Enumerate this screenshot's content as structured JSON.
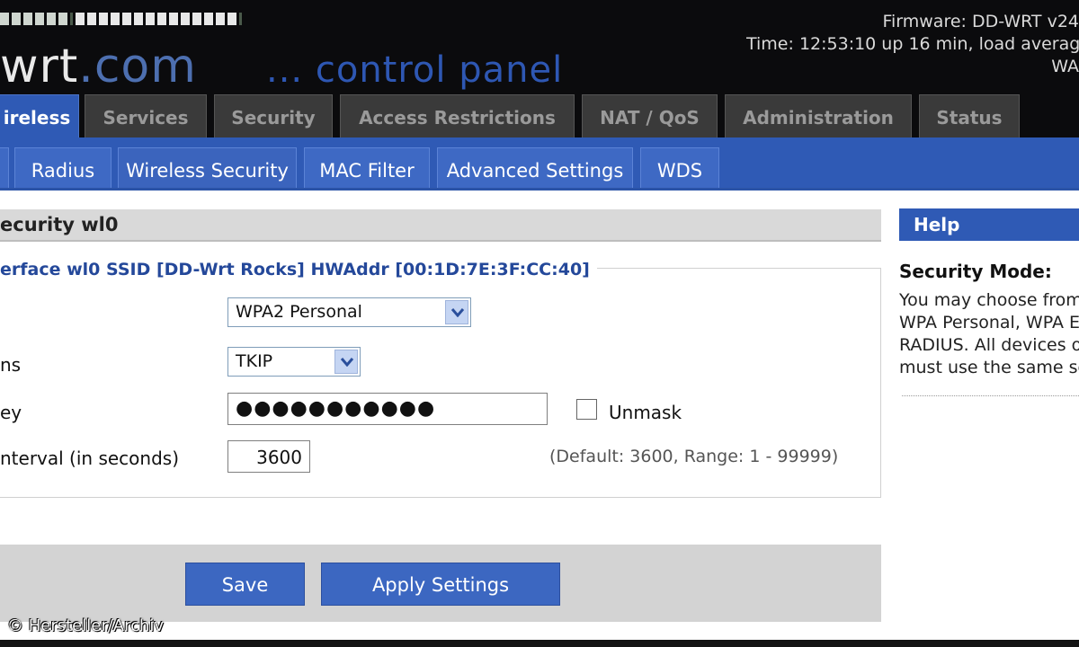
{
  "header": {
    "logo_text": "wrt",
    "logo_suffix": ".com",
    "panel_title": "... control panel",
    "firmware": "Firmware: DD-WRT v24",
    "time": "Time: 12:53:10 up 16 min, load averag",
    "wan": "WA"
  },
  "main_tabs": [
    {
      "label": "ireless",
      "active": true
    },
    {
      "label": "Services"
    },
    {
      "label": "Security"
    },
    {
      "label": "Access Restrictions"
    },
    {
      "label": "NAT / QoS"
    },
    {
      "label": "Administration"
    },
    {
      "label": "Status"
    }
  ],
  "sub_tabs": [
    {
      "label": "Radius"
    },
    {
      "label": "Wireless Security",
      "active": true
    },
    {
      "label": "MAC Filter"
    },
    {
      "label": "Advanced Settings"
    },
    {
      "label": "WDS"
    }
  ],
  "section": {
    "title": "ecurity wl0",
    "legend": "erface wl0 SSID [DD-Wrt Rocks] HWAddr [00:1D:7E:3F:CC:40]"
  },
  "form": {
    "security_mode": {
      "label": "",
      "value": "WPA2 Personal"
    },
    "algorithms": {
      "label": "ns",
      "value": "TKIP"
    },
    "shared_key": {
      "label": "ey",
      "value": "●●●●●●●●●●●",
      "unmask_label": "Unmask"
    },
    "key_renewal": {
      "label": "nterval (in seconds)",
      "value": "3600",
      "hint": "(Default: 3600, Range: 1 - 99999)"
    }
  },
  "buttons": {
    "save": "Save",
    "apply": "Apply Settings"
  },
  "help": {
    "header": "Help",
    "title": "Security Mode:",
    "lines": [
      "You may choose from",
      "WPA Personal, WPA E",
      "RADIUS. All devices o",
      "must use the same se"
    ]
  },
  "watermark": "© Hersteller/Archiv",
  "colors": {
    "accent_blue": "#2f5ab5",
    "header_bg": "#0b0b0d",
    "inactive_tab": "#3a3a3a"
  }
}
